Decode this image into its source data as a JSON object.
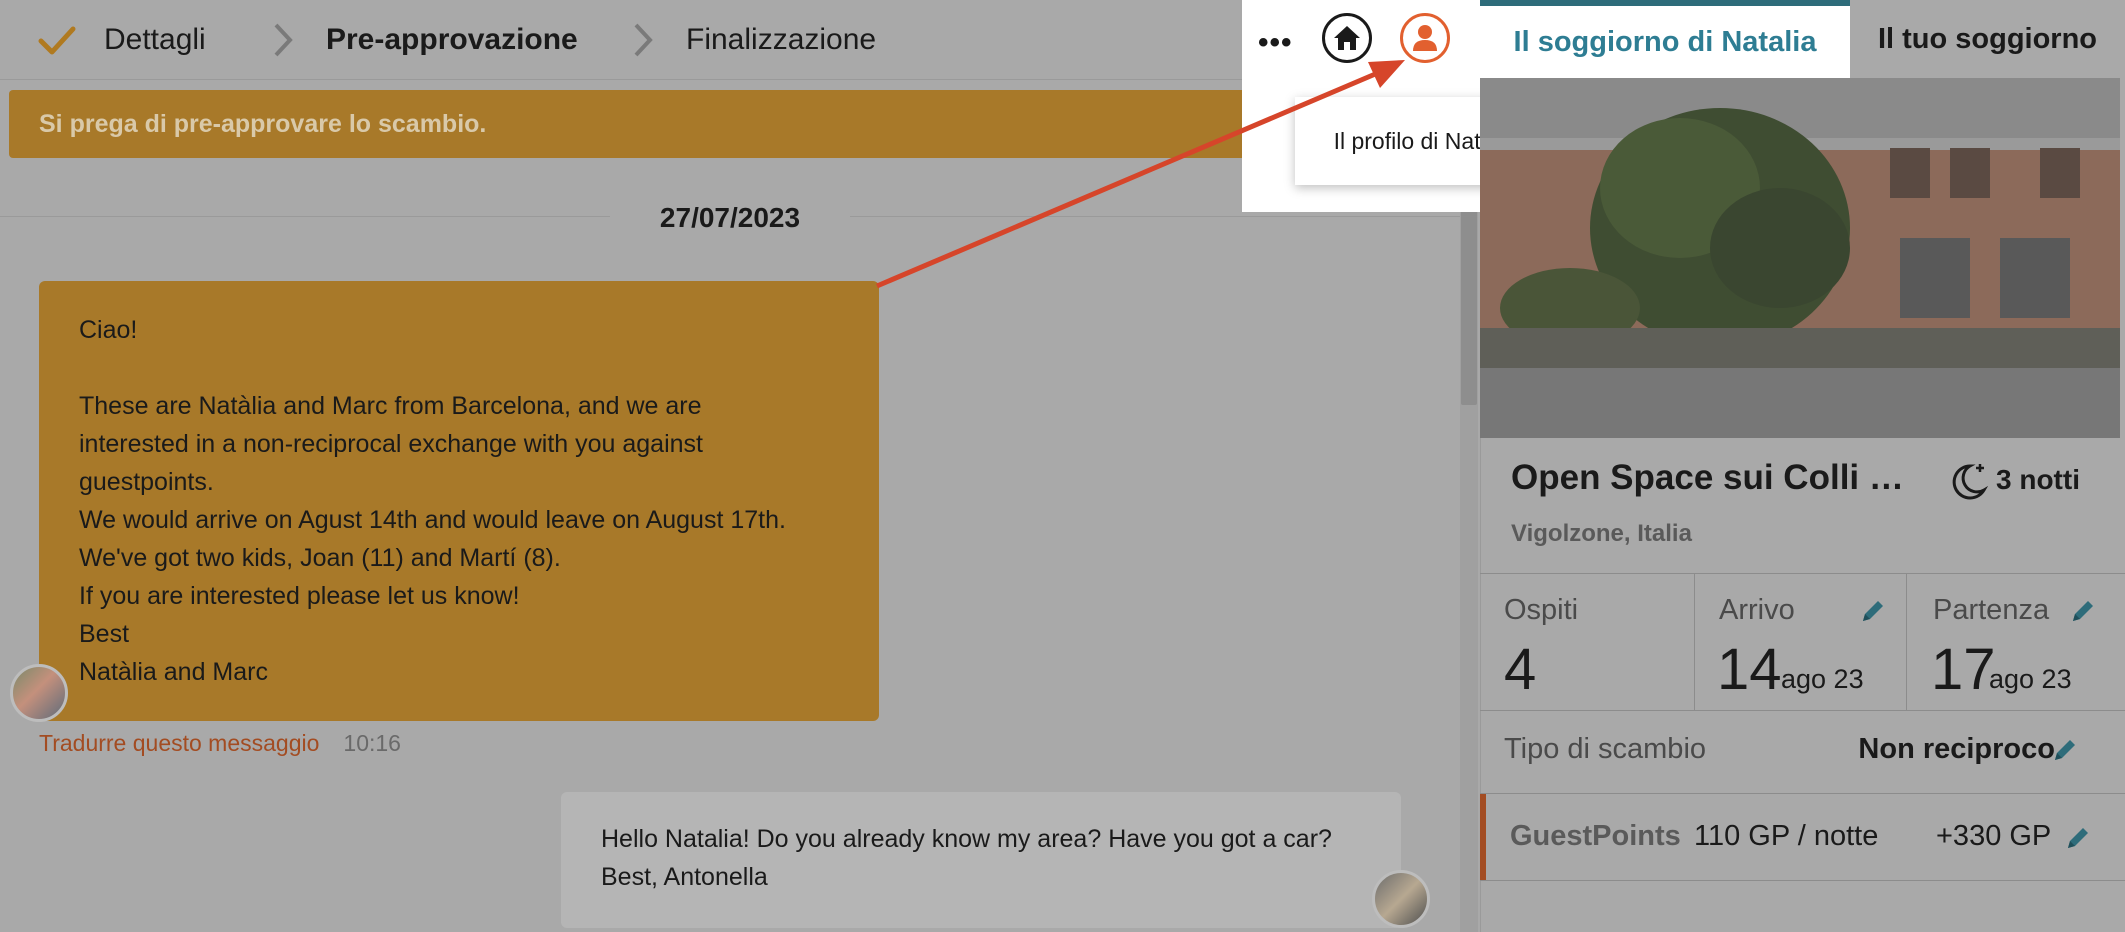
{
  "stepper": {
    "steps": [
      {
        "label": "Dettagli"
      },
      {
        "label": "Pre-approvazione"
      },
      {
        "label": "Finalizzazione"
      }
    ]
  },
  "banner": {
    "text": "Si prega di pre-approvare lo scambio."
  },
  "conversation": {
    "date": "27/07/2023",
    "incoming": {
      "lines": [
        "Ciao!",
        "",
        "These are Natàlia and Marc from Barcelona, and we are",
        "interested in a non-reciprocal exchange with you against",
        "guestpoints.",
        "We would arrive on Agust 14th and would leave on August 17th.",
        "We've got two kids, Joan (11) and Martí (8).",
        "If you are interested please let us know!",
        "Best",
        "Natàlia and Marc"
      ],
      "translate_label": "Tradurre questo messaggio",
      "time": "10:16"
    },
    "outgoing": {
      "text": "Hello Natalia! Do you already know my area? Have you got a car? Best, Antonella"
    }
  },
  "header_actions": {
    "more_label": "•••",
    "tooltip": "Il profilo di Natalia"
  },
  "tabs": [
    {
      "label": "Il soggiorno di Natalia"
    },
    {
      "label": "Il tuo soggiorno"
    }
  ],
  "listing": {
    "title": "Open Space sui Colli …",
    "nights": "3 notti",
    "location": "Vigolzone, Italia",
    "guests": {
      "label": "Ospiti",
      "value": "4"
    },
    "arrival": {
      "label": "Arrivo",
      "day": "14",
      "month": "ago 23"
    },
    "departure": {
      "label": "Partenza",
      "day": "17",
      "month": "ago 23"
    },
    "exchange": {
      "label": "Tipo di scambio",
      "value": "Non reciproco"
    },
    "guestpoints": {
      "label": "GuestPoints",
      "rate": "110 GP / notte",
      "total": "+330 GP"
    }
  },
  "colors": {
    "accent_orange": "#e2602f",
    "teal": "#2e7d93",
    "arrow": "#d6452a"
  }
}
